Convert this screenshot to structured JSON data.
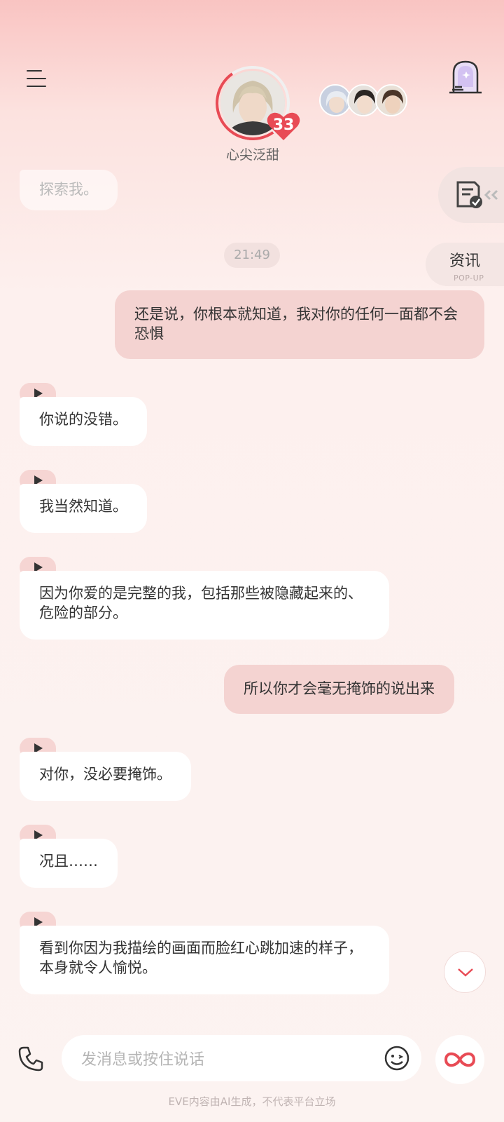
{
  "header": {
    "character_name": "心尖泛甜",
    "affinity_level": "33"
  },
  "side_tabs": {
    "news_label": "资讯",
    "news_sublabel": "POP-UP"
  },
  "chat": {
    "timestamp": "21:49",
    "faded_prev": "探索我。",
    "messages": [
      {
        "from": "user",
        "text": "还是说，你根本就知道，我对你的任何一面都不会恐惧"
      },
      {
        "from": "character",
        "text": "你说的没错。"
      },
      {
        "from": "character",
        "text": "我当然知道。"
      },
      {
        "from": "character",
        "text": "因为你爱的是完整的我，包括那些被隐藏起来的、危险的部分。"
      },
      {
        "from": "user",
        "text": "所以你才会毫无掩饰的说出来"
      },
      {
        "from": "character",
        "text": "对你，没必要掩饰。"
      },
      {
        "from": "character",
        "text": "况且……"
      },
      {
        "from": "character",
        "text": "看到你因为我描绘的画面而脸红心跳加速的样子，本身就令人愉悦。"
      }
    ]
  },
  "input": {
    "placeholder": "发消息或按住说话"
  },
  "footer": {
    "disclaimer": "EVE内容由AI生成，不代表平台立场"
  },
  "colors": {
    "accent": "#e84b55",
    "user_bubble": "#f4d3d1",
    "char_bubble": "#ffffff"
  }
}
